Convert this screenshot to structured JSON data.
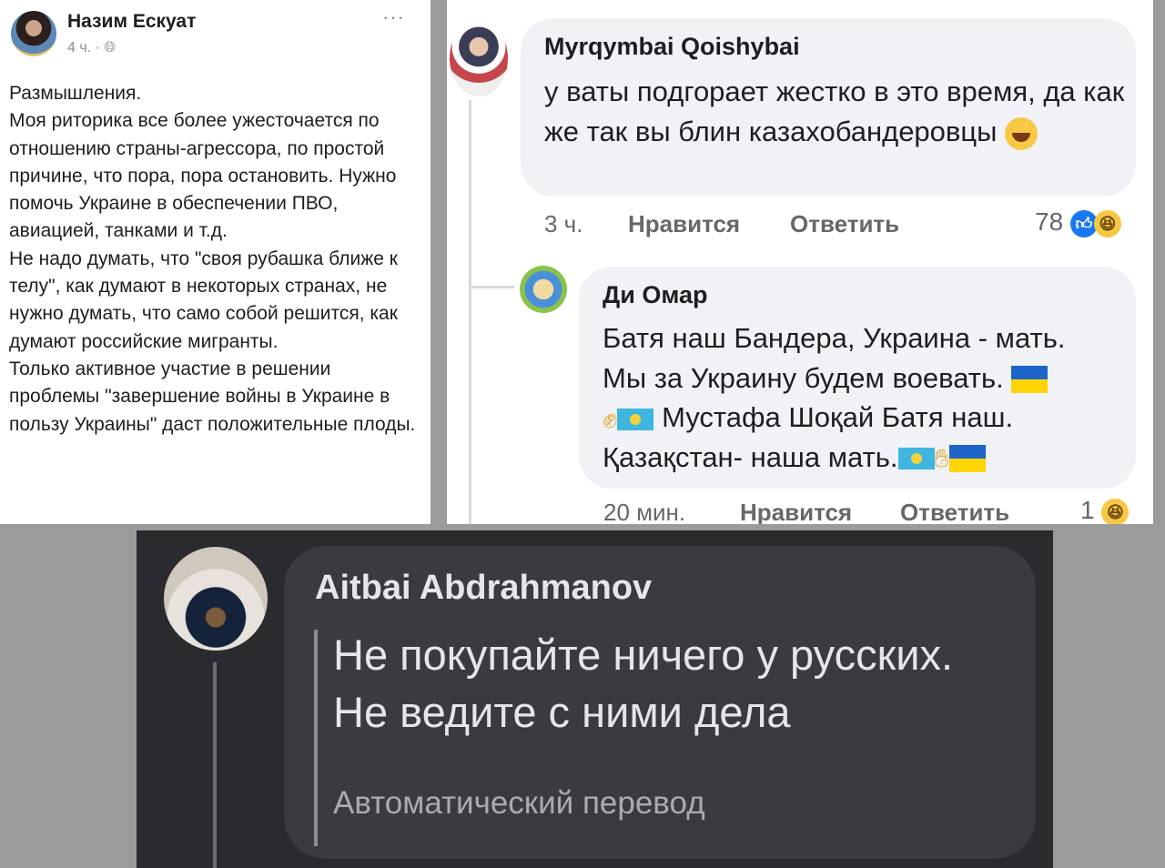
{
  "post": {
    "author": "Назим Ескуат",
    "meta": "4 ч. · ",
    "privacy_icon": "globe-icon",
    "more_icon": "···",
    "paragraphs": [
      "Размышления.",
      "Моя риторика все более ужесточается по отношению страны-агрессора, по простой причине, что пора, пора остановить. Нужно помочь Украине в обеспечении ПВО, авиацией, танками и т.д.",
      "Не надо думать, что \"своя рубашка ближе к телу\", как думают в некоторых странах, не нужно думать, что само собой решится, как думают российские мигранты.",
      "Только активное участие в решении проблемы \"завершение войны в Украине в пользу Украины\" даст положительные плоды."
    ]
  },
  "comments": [
    {
      "author": "Myrqymbai Qoishybai",
      "text": "у ваты подгорает жестко в это время, да как же так вы блин казахобандеровцы",
      "emoji": "laughing-tears-emoji",
      "time": "3 ч.",
      "like_label": "Нравится",
      "reply_label": "Ответить",
      "reaction_count": "78"
    },
    {
      "author": "Ди Омар",
      "line1": "Батя наш Бандера, Украина - мать.",
      "line2": "Мы за Украину будем воевать.",
      "line3": "Мустафа Шоқай Батя наш.",
      "line4": "Қазақстан- наша мать.",
      "time": "20 мин.",
      "like_label": "Нравится",
      "reply_label": "Ответить",
      "reaction_count": "1"
    }
  ],
  "dark_comment": {
    "author": "Aitbai Abdrahmanov",
    "text": "Не покупайте ничего у русских. Не ведите с ними дела",
    "translation_label": "Автоматический перевод"
  },
  "colors": {
    "fb_text": "#1c1e21",
    "fb_secondary": "#65676b",
    "bubble": "#f0f2f5",
    "dark_bg": "#2a2b2e",
    "dark_bubble": "#3a3b3e",
    "like_blue": "#1877f2",
    "ua_blue": "#1e64c8",
    "ua_yellow": "#ffd400",
    "kz_blue": "#3fb6e0"
  }
}
